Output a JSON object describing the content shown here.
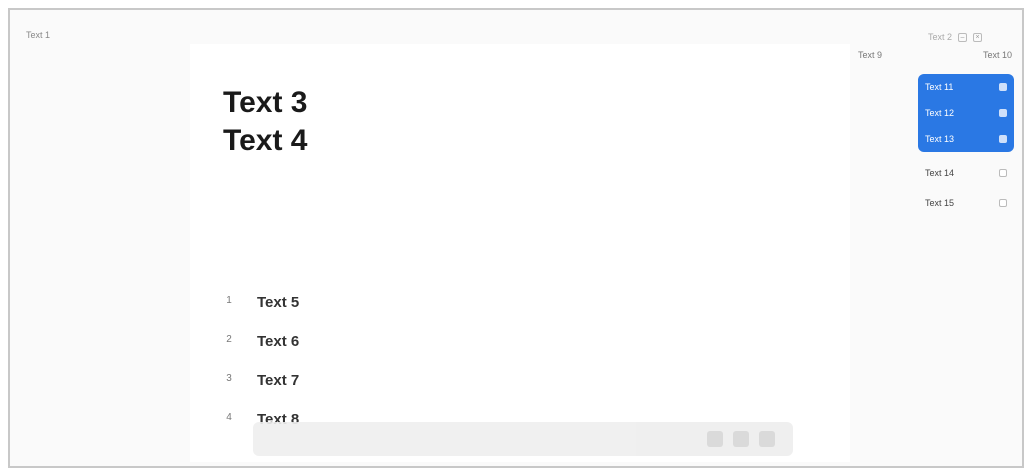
{
  "app": {
    "title": "Text 1"
  },
  "topbar": {
    "status": "Text 2",
    "icons": [
      "minimize-icon",
      "close-icon"
    ]
  },
  "slide": {
    "question": "Text 3\nText 4",
    "options": [
      {
        "number": "1",
        "label": "Text 5"
      },
      {
        "number": "2",
        "label": "Text 6"
      },
      {
        "number": "3",
        "label": "Text 7"
      },
      {
        "number": "4",
        "label": "Text 8"
      }
    ]
  },
  "panel": {
    "header": {
      "left_link": "Text 9",
      "right_link": "Text 10"
    },
    "items": [
      {
        "label": "Text 11",
        "active": true
      },
      {
        "label": "Text 12",
        "active": true
      },
      {
        "label": "Text 13",
        "active": true
      },
      {
        "label": "Text 14",
        "active": false
      },
      {
        "label": "Text 15",
        "active": false
      }
    ]
  },
  "colors": {
    "accent": "#2a78e4",
    "frame_border": "#c8c8c8",
    "question_text": "#1a1a1a"
  }
}
